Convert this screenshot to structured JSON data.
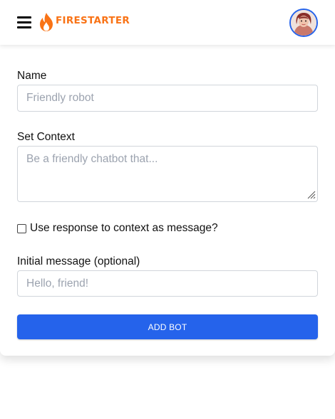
{
  "header": {
    "brand_name": "FIRESTARTER",
    "brand_icon": "flame-icon",
    "menu_icon": "hamburger-menu-icon",
    "avatar_icon": "user-avatar",
    "accent_color": "#f97316",
    "avatar_ring_color": "#2563eb"
  },
  "form": {
    "name_label": "Name",
    "name_placeholder": "Friendly robot",
    "context_label": "Set Context",
    "context_placeholder": "Be a friendly chatbot that...",
    "checkbox_label": "Use response to context as message?",
    "checkbox_checked": false,
    "initial_message_label": "Initial message (optional)",
    "initial_message_placeholder": "Hello, friend!",
    "submit_label": "ADD BOT",
    "button_color": "#2563eb"
  }
}
